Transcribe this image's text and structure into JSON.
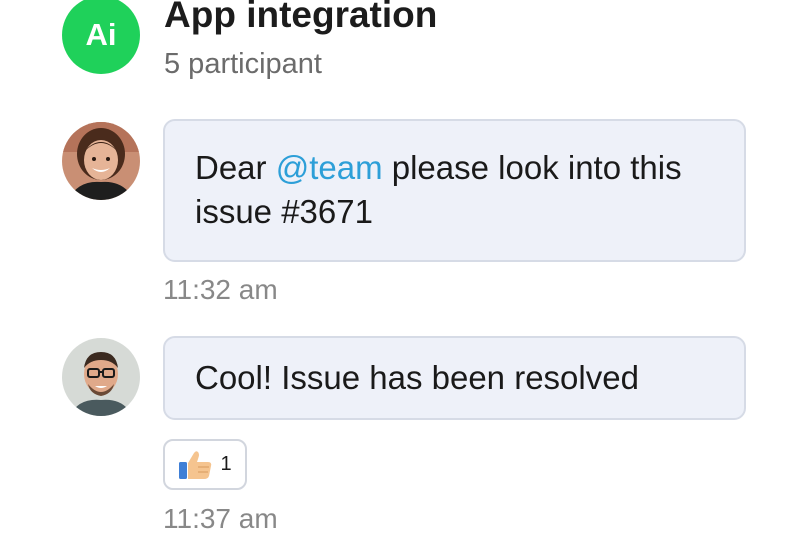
{
  "chat": {
    "avatar_initials": "Ai",
    "title": "App integration",
    "participants": "5 participant"
  },
  "messages": [
    {
      "text_before": "Dear ",
      "mention": "@team",
      "text_after": " please look into this issue #3671",
      "time": "11:32 am"
    },
    {
      "text": "Cool! Issue has been resolved",
      "reaction": {
        "icon": "thumbs-up-icon",
        "count": "1"
      },
      "time": "11:37 am"
    }
  ],
  "colors": {
    "accent_green": "#1fd15a",
    "mention_blue": "#2d9fd8",
    "bubble_bg": "#eef1f9"
  }
}
